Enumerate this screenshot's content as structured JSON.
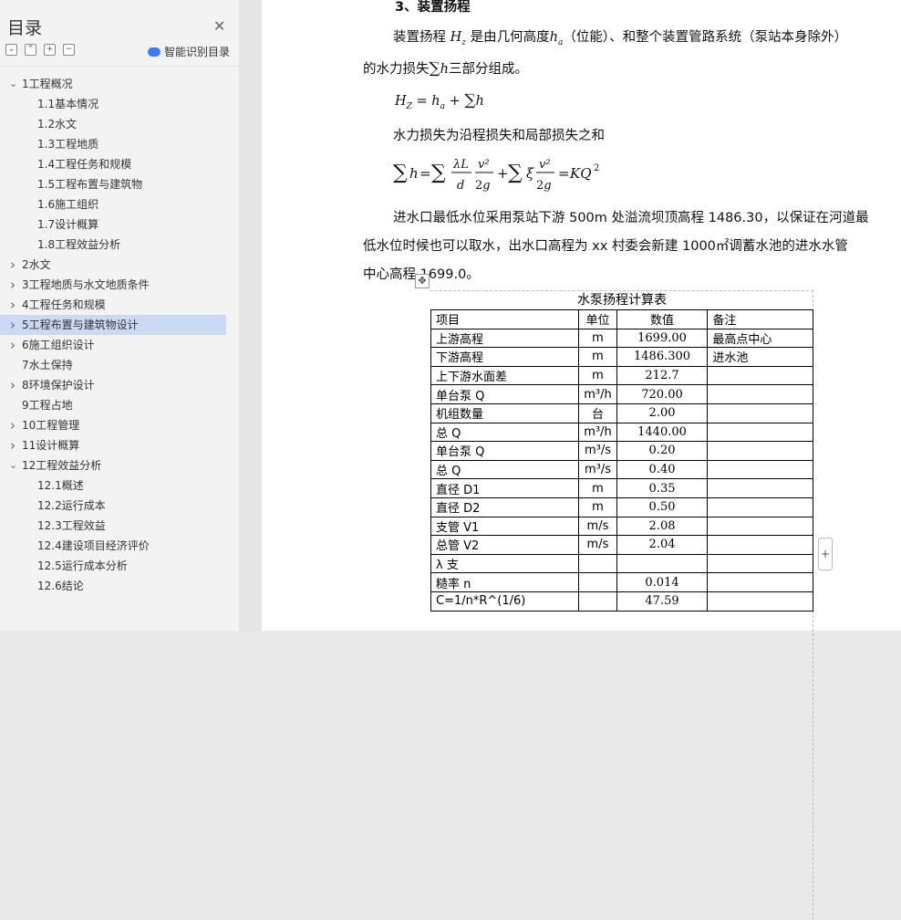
{
  "sidebar": {
    "title": "目录",
    "smart_label": "智能识别目录",
    "items": [
      {
        "label": "1工程概况",
        "level": 1,
        "expanded": true
      },
      {
        "label": "1.1基本情况",
        "level": 2
      },
      {
        "label": "1.2水文",
        "level": 2
      },
      {
        "label": "1.3工程地质",
        "level": 2
      },
      {
        "label": "1.4工程任务和规模",
        "level": 2
      },
      {
        "label": "1.5工程布置与建筑物",
        "level": 2
      },
      {
        "label": "1.6施工组织",
        "level": 2
      },
      {
        "label": "1.7设计概算",
        "level": 2
      },
      {
        "label": "1.8工程效益分析",
        "level": 2
      },
      {
        "label": "2水文",
        "level": 1,
        "expanded": false
      },
      {
        "label": "3工程地质与水文地质条件",
        "level": 1,
        "expanded": false
      },
      {
        "label": "4工程任务和规模",
        "level": 1,
        "expanded": false
      },
      {
        "label": "5工程布置与建筑物设计",
        "level": 1,
        "expanded": false,
        "selected": true
      },
      {
        "label": "6施工组织设计",
        "level": 1,
        "expanded": false
      },
      {
        "label": "7水土保持",
        "level": 1,
        "noarrow": true
      },
      {
        "label": "8环境保护设计",
        "level": 1,
        "expanded": false
      },
      {
        "label": "9工程占地",
        "level": 1,
        "noarrow": true
      },
      {
        "label": "10工程管理",
        "level": 1,
        "expanded": false
      },
      {
        "label": "11设计概算",
        "level": 1,
        "expanded": false
      },
      {
        "label": "12工程效益分析",
        "level": 1,
        "expanded": true
      },
      {
        "label": "12.1概述",
        "level": 2
      },
      {
        "label": "12.2运行成本",
        "level": 2
      },
      {
        "label": "12.3工程效益",
        "level": 2
      },
      {
        "label": "12.4建设项目经济评价",
        "level": 2
      },
      {
        "label": "12.5运行成本分析",
        "level": 2
      },
      {
        "label": "12.6结论",
        "level": 2
      }
    ]
  },
  "doc": {
    "heading": "3、装置扬程",
    "p1_a": "装置扬程",
    "p1_b": "是由几何高度",
    "p1_c": "（位能）、和整个装置管路系统（泵站本身除外）",
    "p2": "的水力损失",
    "p2_b": "三部分组成。",
    "p3": "水力损失为沿程损失和局部损失之和",
    "p4": "进水口最低水位采用泵站下游 500m 处溢流坝顶高程 1486.30，以保证在河道最",
    "p5": "低水位时候也可以取水，出水口高程为 xx 村委会新建 1000㎡调蓄水池的进水水管",
    "p6": "中心高程 1699.0。"
  },
  "table": {
    "title": "水泵扬程计算表",
    "header": [
      "项目",
      "单位",
      "数值",
      "备注"
    ],
    "rows": [
      [
        "上游高程",
        "m",
        "1699.00",
        "最高点中心"
      ],
      [
        "下游高程",
        "m",
        "1486.300",
        "进水池"
      ],
      [
        "上下游水面差",
        "m",
        "212.7",
        ""
      ],
      [
        "单台泵 Q",
        "m³/h",
        "720.00",
        ""
      ],
      [
        "机组数量",
        "台",
        "2.00",
        ""
      ],
      [
        "总 Q",
        "m³/h",
        "1440.00",
        ""
      ],
      [
        "单台泵 Q",
        "m³/s",
        "0.20",
        ""
      ],
      [
        "总 Q",
        "m³/s",
        "0.40",
        ""
      ],
      [
        "直径 D1",
        "m",
        "0.35",
        ""
      ],
      [
        "直径 D2",
        "m",
        "0.50",
        ""
      ],
      [
        "支管 V1",
        "m/s",
        "2.08",
        ""
      ],
      [
        "总管 V2",
        "m/s",
        "2.04",
        ""
      ],
      [
        "λ 支",
        "",
        "",
        ""
      ],
      [
        "糙率 n",
        "",
        "0.014",
        ""
      ],
      [
        "C=1/n*R^(1/6)",
        "",
        "47.59",
        ""
      ]
    ]
  }
}
